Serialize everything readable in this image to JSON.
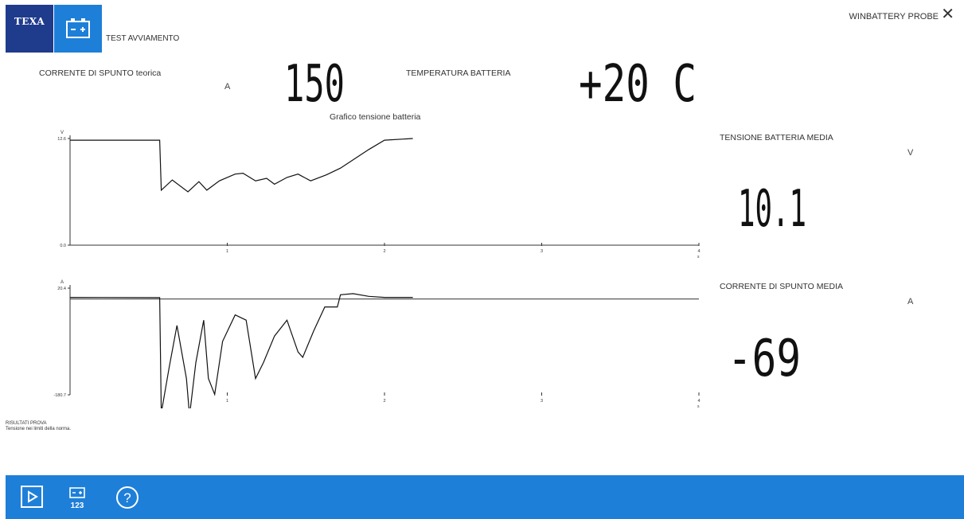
{
  "header": {
    "logo_text": "TEXA",
    "app_icon": "battery-icon",
    "title": "TEST AVVIAMENTO",
    "probe_label": "WINBATTERY PROBE",
    "close_icon": "close-icon"
  },
  "readouts": {
    "corrente_label": "CORRENTE DI SPUNTO teorica",
    "corrente_unit": "A",
    "corrente_value": "150",
    "temperatura_label": "TEMPERATURA BATTERIA",
    "temperatura_value": "+20 C",
    "chart_title": "Grafico tensione batteria",
    "tensione_media_label": "TENSIONE BATTERIA MEDIA",
    "tensione_media_unit": "V",
    "tensione_media_value": "10.1",
    "corrente_media_label": "CORRENTE DI SPUNTO MEDIA",
    "corrente_media_unit": "A",
    "corrente_media_value": "-69"
  },
  "results": {
    "title": "RISULTATI PROVA",
    "text": "Tensione nei limiti della norma."
  },
  "footer": {
    "buttons": [
      {
        "icon": "play-icon"
      },
      {
        "icon": "battery-123-icon",
        "label": "123"
      },
      {
        "icon": "help-icon"
      }
    ],
    "color": "#1e7fd9"
  },
  "chart_data": [
    {
      "type": "line",
      "series": [
        {
          "values_xy": [
            [
              0,
              12.4
            ],
            [
              0.57,
              12.4
            ],
            [
              0.58,
              6.5
            ],
            [
              0.65,
              7.7
            ],
            [
              0.75,
              6.3
            ],
            [
              0.82,
              7.5
            ],
            [
              0.87,
              6.5
            ],
            [
              0.95,
              7.6
            ],
            [
              1.05,
              8.4
            ],
            [
              1.1,
              8.5
            ],
            [
              1.18,
              7.6
            ],
            [
              1.25,
              7.9
            ],
            [
              1.3,
              7.2
            ],
            [
              1.38,
              8.0
            ],
            [
              1.45,
              8.4
            ],
            [
              1.53,
              7.6
            ],
            [
              1.63,
              8.3
            ],
            [
              1.72,
              9.1
            ],
            [
              1.9,
              11.3
            ],
            [
              2.0,
              12.4
            ],
            [
              2.18,
              12.6
            ]
          ]
        }
      ],
      "ylabel": "V",
      "ylim": [
        0.0,
        12.6
      ],
      "yticks": [
        "12.6",
        "0.0"
      ],
      "xlim": [
        0,
        4
      ],
      "xticks": [
        "1",
        "2",
        "3",
        "4"
      ],
      "xunit": "s",
      "grid": false
    },
    {
      "type": "line",
      "series": [
        {
          "values_xy": [
            [
              0,
              3.0
            ],
            [
              0.57,
              2.5
            ],
            [
              0.58,
              -215
            ],
            [
              0.63,
              -130
            ],
            [
              0.68,
              -50
            ],
            [
              0.74,
              -150
            ],
            [
              0.76,
              -220
            ],
            [
              0.8,
              -120
            ],
            [
              0.85,
              -40
            ],
            [
              0.88,
              -150
            ],
            [
              0.92,
              -180
            ],
            [
              0.97,
              -80
            ],
            [
              1.05,
              -30
            ],
            [
              1.12,
              -40
            ],
            [
              1.18,
              -150
            ],
            [
              1.23,
              -120
            ],
            [
              1.3,
              -70
            ],
            [
              1.38,
              -40
            ],
            [
              1.45,
              -100
            ],
            [
              1.48,
              -110
            ],
            [
              1.55,
              -60
            ],
            [
              1.62,
              -15
            ],
            [
              1.7,
              -15
            ],
            [
              1.72,
              8
            ],
            [
              1.8,
              10
            ],
            [
              1.9,
              5
            ],
            [
              2.0,
              3
            ],
            [
              2.18,
              3
            ]
          ]
        }
      ],
      "ylabel": "A",
      "ylim": [
        -180.7,
        20.4
      ],
      "yticks": [
        "20.4",
        "-180.7"
      ],
      "xlim": [
        0,
        4
      ],
      "xticks": [
        "1",
        "2",
        "3",
        "4"
      ],
      "xunit": "s",
      "grid": false
    }
  ]
}
